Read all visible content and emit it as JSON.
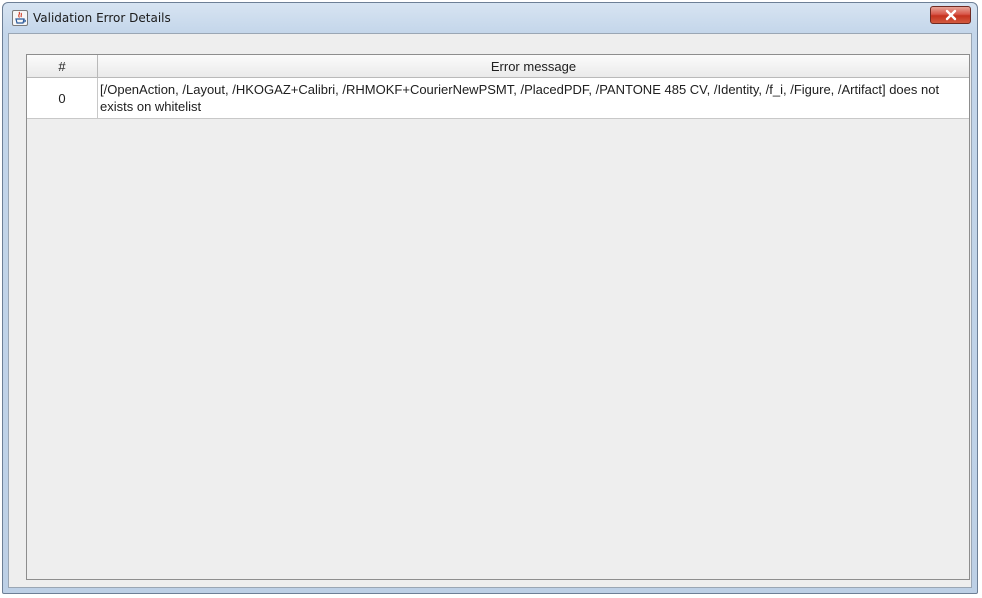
{
  "window": {
    "title": "Validation Error Details",
    "app_icon": "java-icon",
    "close_icon": "close-icon"
  },
  "table": {
    "columns": [
      "#",
      "Error message"
    ],
    "rows": [
      {
        "index": "0",
        "message": "[/OpenAction, /Layout, /HKOGAZ+Calibri, /RHMOKF+CourierNewPSMT, /PlacedPDF, /PANTONE 485 CV, /Identity, /f_i, /Figure, /Artifact] does not exists on whitelist"
      }
    ]
  },
  "colors": {
    "titlebar": "#c4d6ea",
    "close_button": "#c5321f",
    "content_background": "#eeeeee"
  }
}
